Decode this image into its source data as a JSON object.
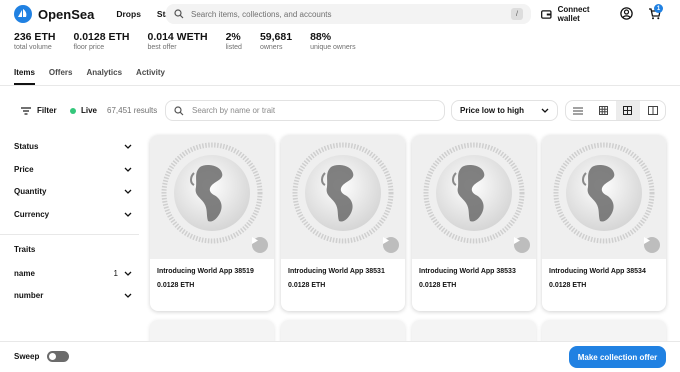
{
  "header": {
    "logo_text": "OpenSea",
    "nav": [
      "Drops",
      "Stats"
    ],
    "search_placeholder": "Search items, collections, and accounts",
    "search_shortcut": "/",
    "connect_label": "Connect wallet",
    "cart_count": "1"
  },
  "stats": [
    {
      "value": "236 ETH",
      "label": "total volume"
    },
    {
      "value": "0.0128 ETH",
      "label": "floor price"
    },
    {
      "value": "0.014 WETH",
      "label": "best offer"
    },
    {
      "value": "2%",
      "label": "listed"
    },
    {
      "value": "59,681",
      "label": "owners"
    },
    {
      "value": "88%",
      "label": "unique owners"
    }
  ],
  "tabs": [
    "Items",
    "Offers",
    "Analytics",
    "Activity"
  ],
  "toolbar": {
    "filter_label": "Filter",
    "live_label": "Live",
    "results": "67,451 results",
    "trait_placeholder": "Search by name or trait",
    "sort_label": "Price low to high"
  },
  "sidebar": {
    "filters": [
      "Status",
      "Price",
      "Quantity",
      "Currency"
    ],
    "traits_heading": "Traits",
    "traits": [
      {
        "name": "name",
        "count": "1"
      },
      {
        "name": "number",
        "count": ""
      }
    ]
  },
  "cards": [
    {
      "name": "Introducing World App 38519",
      "price": "0.0128 ETH"
    },
    {
      "name": "Introducing World App 38531",
      "price": "0.0128 ETH"
    },
    {
      "name": "Introducing World App 38533",
      "price": "0.0128 ETH"
    },
    {
      "name": "Introducing World App 38534",
      "price": "0.0128 ETH"
    }
  ],
  "footer": {
    "sweep_label": "Sweep",
    "offer_label": "Make collection offer"
  },
  "colors": {
    "accent": "#2081E2",
    "live": "#34c77b"
  }
}
